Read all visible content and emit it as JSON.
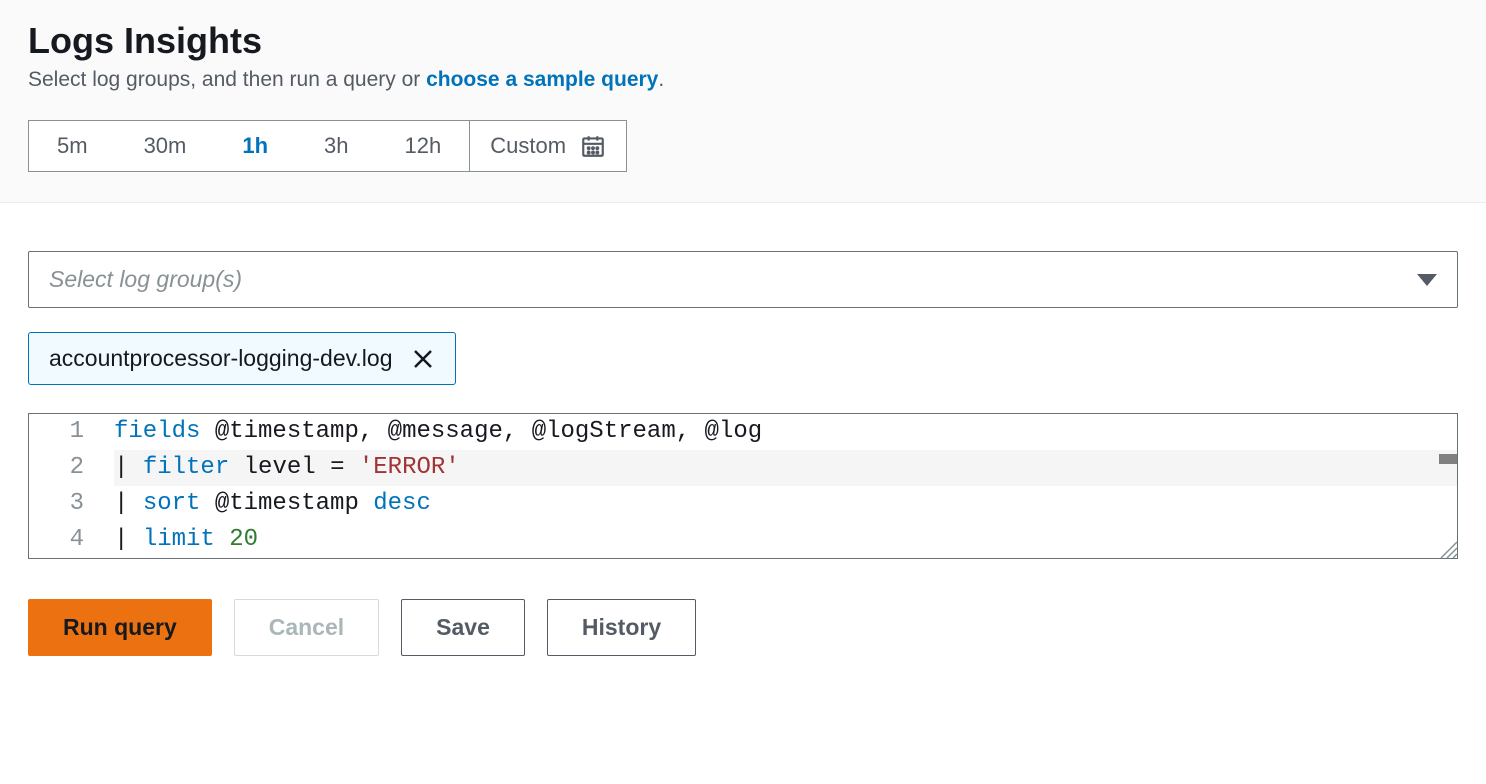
{
  "header": {
    "title": "Logs Insights",
    "subtitle_prefix": "Select log groups, and then run a query or ",
    "subtitle_link": "choose a sample query",
    "subtitle_suffix": "."
  },
  "time_range": {
    "options": [
      "5m",
      "30m",
      "1h",
      "3h",
      "12h"
    ],
    "active": "1h",
    "custom_label": "Custom"
  },
  "log_group_select": {
    "placeholder": "Select log group(s)"
  },
  "selected_tag": {
    "label": "accountprocessor-logging-dev.log"
  },
  "editor": {
    "lines": [
      {
        "n": "1",
        "tokens": [
          {
            "t": "kw",
            "v": "fields"
          },
          {
            "t": "txt",
            "v": " @timestamp"
          },
          {
            "t": "punct",
            "v": ","
          },
          {
            "t": "txt",
            "v": " @message"
          },
          {
            "t": "punct",
            "v": ","
          },
          {
            "t": "txt",
            "v": " @logStream"
          },
          {
            "t": "punct",
            "v": ","
          },
          {
            "t": "txt",
            "v": " @log"
          }
        ]
      },
      {
        "n": "2",
        "current": true,
        "tokens": [
          {
            "t": "punct",
            "v": "| "
          },
          {
            "t": "kw",
            "v": "filter"
          },
          {
            "t": "txt",
            "v": " level "
          },
          {
            "t": "punct",
            "v": "= "
          },
          {
            "t": "str",
            "v": "'ERROR'"
          }
        ]
      },
      {
        "n": "3",
        "tokens": [
          {
            "t": "punct",
            "v": "| "
          },
          {
            "t": "kw",
            "v": "sort"
          },
          {
            "t": "txt",
            "v": " @timestamp "
          },
          {
            "t": "kw",
            "v": "desc"
          }
        ]
      },
      {
        "n": "4",
        "tokens": [
          {
            "t": "punct",
            "v": "| "
          },
          {
            "t": "kw",
            "v": "limit"
          },
          {
            "t": "txt",
            "v": " "
          },
          {
            "t": "num",
            "v": "20"
          }
        ]
      }
    ]
  },
  "actions": {
    "run": "Run query",
    "cancel": "Cancel",
    "save": "Save",
    "history": "History"
  }
}
